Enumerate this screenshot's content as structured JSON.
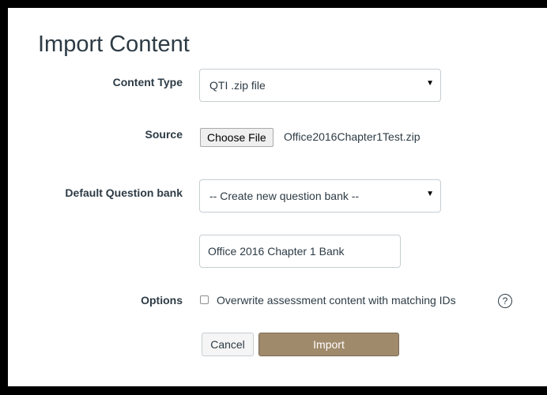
{
  "page": {
    "title": "Import Content"
  },
  "content_type": {
    "label": "Content Type",
    "selected": "QTI .zip file"
  },
  "source": {
    "label": "Source",
    "button_label": "Choose File",
    "file_name": "Office2016Chapter1Test.zip"
  },
  "question_bank": {
    "label": "Default Question bank",
    "selected": "-- Create new question bank --",
    "new_bank_name": "Office 2016 Chapter 1 Bank"
  },
  "options": {
    "label": "Options",
    "overwrite_label": "Overwrite assessment content with matching IDs",
    "overwrite_checked": false,
    "help_glyph": "?"
  },
  "actions": {
    "cancel_label": "Cancel",
    "import_label": "Import"
  },
  "colors": {
    "import_button": "#a08a6c",
    "text": "#2d3b45"
  }
}
